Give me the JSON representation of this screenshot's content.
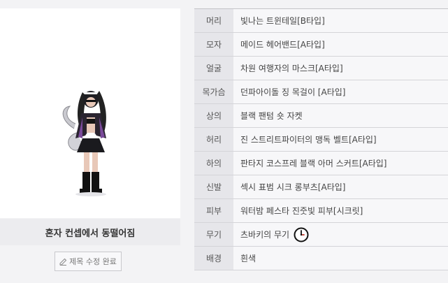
{
  "character": {
    "title": "혼자 컨셉에서 동떨어짐",
    "edit_button_label": "제목 수정 완료"
  },
  "equipment": [
    {
      "slot": "머리",
      "item": "빛나는 트윈테일[B타입]"
    },
    {
      "slot": "모자",
      "item": "메이드 헤어밴드[A타입]"
    },
    {
      "slot": "얼굴",
      "item": "차원 여행자의 마스크[A타입]"
    },
    {
      "slot": "목가슴",
      "item": "던파아이돌 징 목걸이 [A타입]"
    },
    {
      "slot": "상의",
      "item": "블랙 팬텀 숏 자켓"
    },
    {
      "slot": "허리",
      "item": "진 스트리트파이터의 맹독 벨트[A타입]"
    },
    {
      "slot": "하의",
      "item": "판타지 코스프레 블랙 아머 스커트[A타입]"
    },
    {
      "slot": "신발",
      "item": "섹시 표범 시크 롱부츠[A타입]"
    },
    {
      "slot": "피부",
      "item": "워터밤 페스타 진줏빛 피부[시크릿]"
    },
    {
      "slot": "무기",
      "item": "츠바키의 무기",
      "icon": "clock-icon"
    },
    {
      "slot": "배경",
      "item": "흰색"
    }
  ]
}
